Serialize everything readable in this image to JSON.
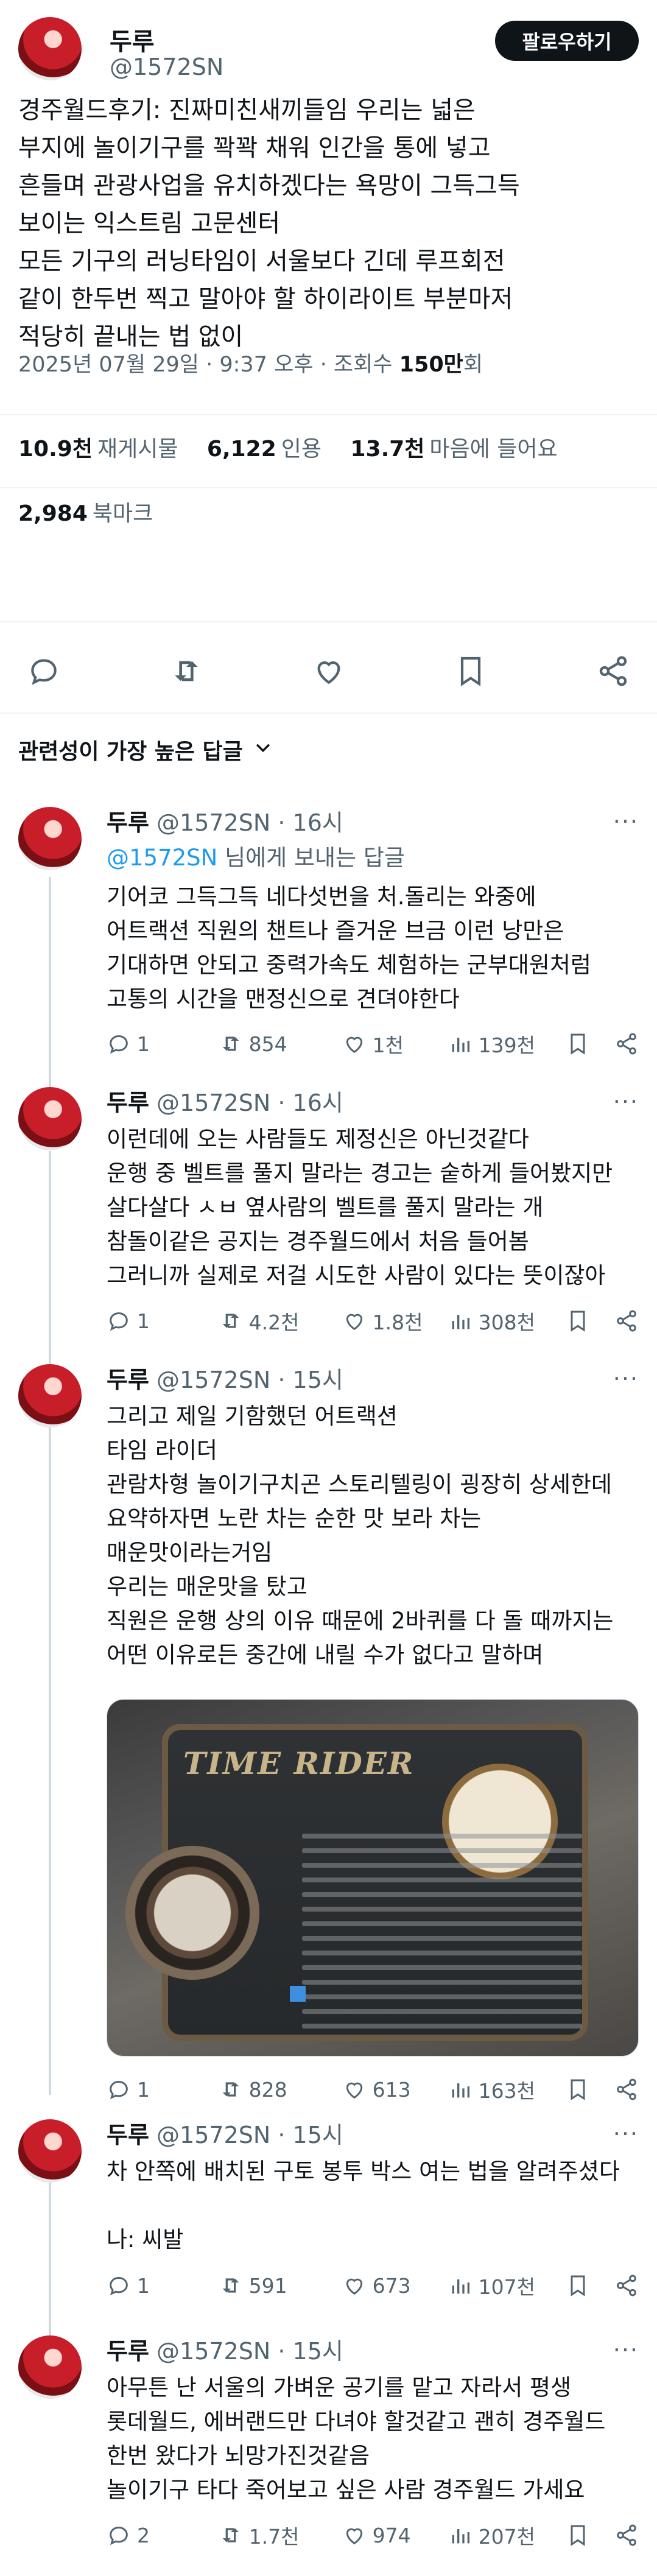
{
  "main": {
    "author_name": "두루",
    "author_handle": "@1572SN",
    "follow_label": "팔로우하기",
    "text": "경주월드후기: 진짜미친새끼들임 우리는 넓은\n부지에 놀이기구를 꽉꽉 채워 인간을 통에 넣고\n흔들며 관광사업을 유치하겠다는 욕망이 그득그득\n보이는 익스트림 고문센터\n모든 기구의 러닝타임이 서울보다 긴데 루프회전\n같이 한두번 찍고 말아야 할 하이라이트 부분마저\n적당히 끝내는 법 없이",
    "timestamp": "2025년 07월 29일 · 9:37 오후 · 조회수",
    "views": "150만",
    "views_suffix": "회",
    "stats": {
      "reposts_value": "10.9천",
      "reposts_label": "재게시물",
      "quotes_value": "6,122",
      "quotes_label": "인용",
      "likes_value": "13.7천",
      "likes_label": "마음에 들어요",
      "bookmarks_value": "2,984",
      "bookmarks_label": "북마크"
    }
  },
  "sort_label": "관련성이 가장 높은 답글",
  "replies": [
    {
      "name": "두루",
      "handle": "@1572SN",
      "time": "· 16시",
      "reply_to_prefix": "",
      "reply_to_handle": "@1572SN",
      "reply_to_suffix": " 님에게 보내는 답글",
      "text": "기어코 그득그득 네다섯번을 처.돌리는 와중에\n어트랙션 직원의 챈트나 즐거운 브금 이런 낭만은\n기대하면 안되고 중력가속도 체험하는 군부대원처럼\n고통의 시간을 맨정신으로 견뎌야한다",
      "replies": "1",
      "reposts": "854",
      "likes": "1천",
      "views": "139천"
    },
    {
      "name": "두루",
      "handle": "@1572SN",
      "time": "· 16시",
      "text": "이런데에 오는 사람들도 제정신은 아닌것같다\n운행 중 벨트를 풀지 말라는 경고는 숱하게 들어봤지만\n살다살다 ㅅㅂ 옆사람의 벨트를 풀지 말라는 개\n참돌이같은 공지는 경주월드에서 처음 들어봄\n그러니까 실제로 저걸 시도한 사람이 있다는 뜻이잖아",
      "replies": "1",
      "reposts": "4.2천",
      "likes": "1.8천",
      "views": "308천"
    },
    {
      "name": "두루",
      "handle": "@1572SN",
      "time": "· 15시",
      "text": "그리고 제일 기함했던 어트랙션\n타임 라이더\n관람차형 놀이기구치곤 스토리텔링이 굉장히 상세한데\n요약하자면 노란 차는 순한 맛 보라 차는\n매운맛이라는거임\n우리는 매운맛을 탔고\n직원은 운행 상의 이유 때문에 2바퀴를 다 돌 때까지는\n어떤 이유로든 중간에 내릴 수가 없다고 말하며",
      "photo_sign": "TIME RIDER",
      "replies": "1",
      "reposts": "828",
      "likes": "613",
      "views": "163천"
    },
    {
      "name": "두루",
      "handle": "@1572SN",
      "time": "· 15시",
      "text": "차 안쪽에 배치된 구토 봉투 박스 여는 법을 알려주셨다\n\n나: 씨발",
      "replies": "1",
      "reposts": "591",
      "likes": "673",
      "views": "107천"
    },
    {
      "name": "두루",
      "handle": "@1572SN",
      "time": "· 15시",
      "text": "아무튼 난 서울의 가벼운 공기를 맡고 자라서 평생\n롯데월드, 에버랜드만 다녀야 할것같고 괜히 경주월드\n한번 왔다가 뇌망가진것같음\n놀이기구 타다 죽어보고 싶은 사람 경주월드 가세요",
      "replies": "2",
      "reposts": "1.7천",
      "likes": "974",
      "views": "207천"
    }
  ],
  "icons": [
    "reply-icon",
    "retweet-icon",
    "like-icon",
    "bookmark-icon",
    "share-icon",
    "views-icon",
    "more-icon",
    "chevron-down-icon"
  ]
}
